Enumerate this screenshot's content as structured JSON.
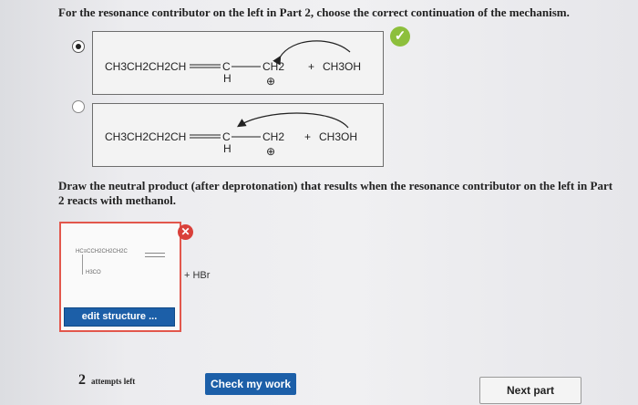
{
  "part2": {
    "question": "For the resonance contributor on the left in Part 2, choose the correct continuation of the mechanism.",
    "options": [
      {
        "selected": true,
        "left": "CH3CH2CH2CH",
        "c": "C",
        "h": "H",
        "ch2": "CH2",
        "plus": "+",
        "reagent": "CH3OH",
        "charge": "⊕"
      },
      {
        "selected": false,
        "left": "CH3CH2CH2CH",
        "c": "C",
        "h": "H",
        "ch2": "CH2",
        "plus": "+",
        "reagent": "CH3OH",
        "charge": "⊕"
      }
    ],
    "correct_icon": "check-icon"
  },
  "part3": {
    "question": "Draw the neutral product (after deprotonation) that results when the resonance contributor on the left in Part 2 reacts with methanol.",
    "structure_top": "HC≡CCH2CH2CH2C",
    "structure_bottom": "H3CO",
    "byproduct": "+ HBr",
    "edit_label": "edit structure ...",
    "error_icon": "x-icon"
  },
  "footer": {
    "attempts_count": "2",
    "attempts_label": "attempts left",
    "check_label": "Check my work",
    "next_label": "Next part"
  },
  "colors": {
    "button_blue": "#1c5fa8",
    "correct_green": "#8dbf3c",
    "error_red": "#d9403a"
  }
}
